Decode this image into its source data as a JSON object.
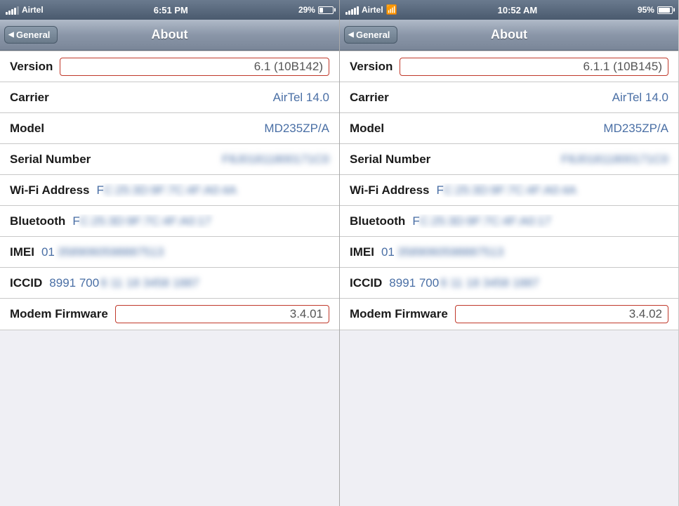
{
  "panel1": {
    "statusBar": {
      "carrier": "Airtel",
      "time": "6:51 PM",
      "battery": "29%",
      "batteryWidth": "29"
    },
    "navBar": {
      "backLabel": "General",
      "title": "About"
    },
    "rows": [
      {
        "label": "Version",
        "value": "6.1 (10B142)",
        "type": "highlighted"
      },
      {
        "label": "Carrier",
        "value": "AirTel 14.0",
        "type": "blue"
      },
      {
        "label": "Model",
        "value": "MD235ZP/A",
        "type": "blue"
      },
      {
        "label": "Serial Number",
        "value": "F8J0181180017110",
        "type": "blurred"
      },
      {
        "label": "Wi-Fi Address",
        "value": "FC:25:3D:9F:7C:4F:A0:4A",
        "type": "blurred-prefix",
        "prefix": "F"
      },
      {
        "label": "Bluetooth",
        "value": "FC:25:3D:9F:7C:4F:A0:17",
        "type": "blurred-prefix",
        "prefix": "F"
      },
      {
        "label": "IMEI",
        "value": "35890605988875 1 3",
        "type": "imei",
        "prefix": "01"
      },
      {
        "label": "ICCID",
        "value": "8991 7000 11 18 3458 1887",
        "type": "iccid",
        "prefix": "8991 700"
      },
      {
        "label": "Modem Firmware",
        "value": "3.4.01",
        "type": "highlighted"
      }
    ]
  },
  "panel2": {
    "statusBar": {
      "carrier": "Airtel",
      "time": "10:52 AM",
      "battery": "95%",
      "batteryWidth": "90",
      "wifi": true
    },
    "navBar": {
      "backLabel": "General",
      "title": "About"
    },
    "rows": [
      {
        "label": "Version",
        "value": "6.1.1 (10B145)",
        "type": "highlighted"
      },
      {
        "label": "Carrier",
        "value": "AirTel 14.0",
        "type": "blue"
      },
      {
        "label": "Model",
        "value": "MD235ZP/A",
        "type": "blue"
      },
      {
        "label": "Serial Number",
        "value": "F8J0181180017110",
        "type": "blurred"
      },
      {
        "label": "Wi-Fi Address",
        "value": "FC:25:3D:9F:7C:4F:A0:4A",
        "type": "blurred-prefix",
        "prefix": "F"
      },
      {
        "label": "Bluetooth",
        "value": "FC:25:3D:9F:7C:4F:A0:17",
        "type": "blurred-prefix",
        "prefix": "F"
      },
      {
        "label": "IMEI",
        "value": "35890605988875 1 3",
        "type": "imei",
        "prefix": "01"
      },
      {
        "label": "ICCID",
        "value": "8991 7000 11 18 3458 1887",
        "type": "iccid",
        "prefix": "8991 700"
      },
      {
        "label": "Modem Firmware",
        "value": "3.4.02",
        "type": "highlighted"
      }
    ]
  }
}
